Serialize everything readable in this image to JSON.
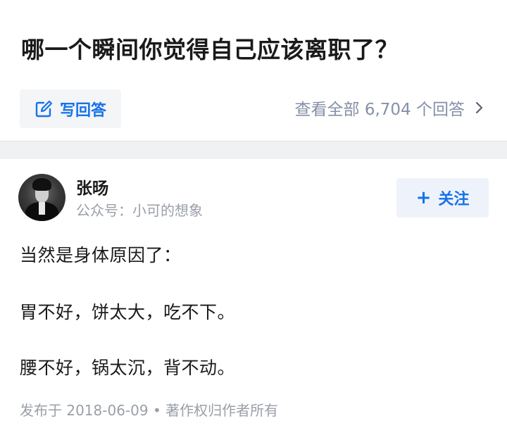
{
  "question": {
    "title": "哪一个瞬间你觉得自己应该离职了？",
    "write_answer_label": "写回答",
    "view_all_label": "查看全部 6,704 个回答"
  },
  "answer": {
    "author_name": "张旸",
    "author_desc": "公众号：小可的想象",
    "follow_label": "关注",
    "lines": [
      "当然是身体原因了：",
      "胃不好，饼太大，吃不下。",
      "腰不好，锅太沉，背不动。"
    ],
    "meta": "发布于 2018-06-09 • 著作权归作者所有"
  },
  "colors": {
    "accent": "#1772e8",
    "muted": "#9a9fa8",
    "divider": "#f0f1f3"
  },
  "icons": {
    "write": "edit-icon",
    "chevron": "chevron-right-icon",
    "plus": "plus-icon"
  }
}
